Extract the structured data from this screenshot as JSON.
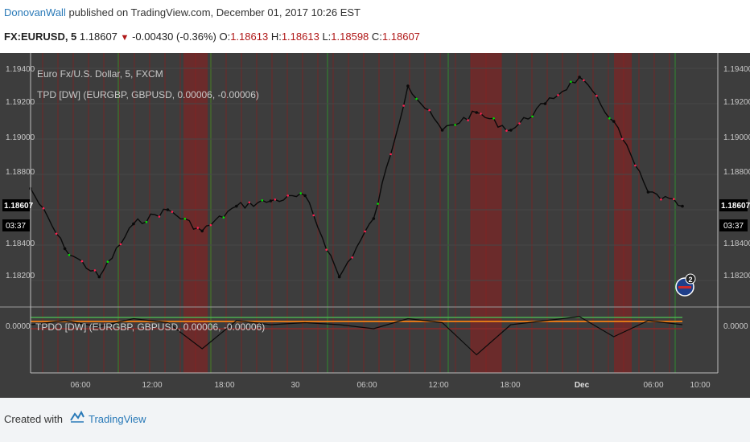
{
  "header": {
    "author": "DonovanWall",
    "published_text": " published on TradingView.com, December 01, 2017 10:26 EST",
    "symbol": "FX:EURUSD, 5",
    "last_price": "1.18607",
    "change": "-0.00430 (-0.36%)",
    "open_label": "O:",
    "open": "1.18613",
    "high_label": "H:",
    "high": "1.18613",
    "low_label": "L:",
    "low": "1.18598",
    "close_label": "C:",
    "close": "1.18607"
  },
  "legend": {
    "instrument": "Euro Fx/U.S. Dollar, 5, FXCM",
    "indicator": "TPD [DW] (EURGBP, GBPUSD, 0.00006, -0.00006)",
    "oscillator": "TPDO [DW] (EURGBP, GBPUSD, 0.00006, -0.00006)"
  },
  "price_axis": {
    "ticks": [
      "1.19400",
      "1.19200",
      "1.19000",
      "1.18800",
      "1.18400",
      "1.18200"
    ],
    "current_price": "1.18607",
    "countdown": "03:37"
  },
  "osc_axis": {
    "ticks": [
      "0.0000"
    ]
  },
  "time_axis": {
    "ticks": [
      "06:00",
      "12:00",
      "18:00",
      "30",
      "06:00",
      "12:00",
      "18:00",
      "Dec",
      "06:00",
      "10:00"
    ]
  },
  "event_badge": {
    "count": "2"
  },
  "colors": {
    "background": "#3d3d3d",
    "price_line": "#0a0a0a",
    "bull_signal": "#00e000",
    "bear_signal": "#ff2050",
    "bear_zone": "#8a1f1f",
    "bull_zone_line": "#2f8a2f",
    "osc_band_orange": "#e07818",
    "osc_band_green": "#4caf50"
  },
  "chart_data": [
    {
      "type": "line",
      "title": "Euro Fx/U.S. Dollar, 5, FXCM",
      "xlabel": "",
      "ylabel": "",
      "x": [
        "Nov 29 00:00",
        "Nov 29 03:00",
        "Nov 29 06:00",
        "Nov 29 09:00",
        "Nov 29 12:00",
        "Nov 29 15:00",
        "Nov 29 18:00",
        "Nov 29 21:00",
        "Nov 30 00:00",
        "Nov 30 03:00",
        "Nov 30 06:00",
        "Nov 30 09:00",
        "Nov 30 12:00",
        "Nov 30 15:00",
        "Nov 30 18:00",
        "Nov 30 21:00",
        "Dec 01 00:00",
        "Dec 01 03:00",
        "Dec 01 06:00",
        "Dec 01 08:40"
      ],
      "series": [
        {
          "name": "",
          "values": [
            1.1872,
            1.1838,
            1.1822,
            1.1852,
            1.186,
            1.1848,
            1.1862,
            1.1865,
            1.1868,
            1.1822,
            1.1855,
            1.193,
            1.1905,
            1.1915,
            1.1905,
            1.192,
            1.1935,
            1.191,
            1.187,
            1.1862
          ]
        }
      ],
      "ylim": [
        1.181,
        1.1945
      ],
      "y_ticks": [
        1.182,
        1.184,
        1.186,
        1.188,
        1.19,
        1.192,
        1.194
      ]
    },
    {
      "type": "line",
      "title": "TPDO [DW] (EURGBP, GBPUSD, 0.00006, -0.00006)",
      "xlabel": "",
      "ylabel": "",
      "x": [
        "Nov 29 00:00",
        "Nov 29 03:00",
        "Nov 29 06:00",
        "Nov 29 09:00",
        "Nov 29 12:00",
        "Nov 29 15:00",
        "Nov 29 18:00",
        "Nov 29 21:00",
        "Nov 30 00:00",
        "Nov 30 03:00",
        "Nov 30 06:00",
        "Nov 30 09:00",
        "Nov 30 12:00",
        "Nov 30 15:00",
        "Nov 30 18:00",
        "Nov 30 21:00",
        "Dec 01 00:00",
        "Dec 01 03:00",
        "Dec 01 06:00",
        "Dec 01 08:40"
      ],
      "series": [
        {
          "name": "",
          "values": [
            0.0,
            2e-05,
            -1e-05,
            3e-05,
            1e-05,
            -0.00012,
            2e-05,
            0.0,
            1e-05,
            0.0,
            -2e-05,
            3e-05,
            1e-05,
            -0.00015,
            0.0,
            2e-05,
            4e-05,
            -6e-05,
            2e-05,
            0.0
          ]
        }
      ],
      "bands": [
        6e-05,
        -6e-05
      ],
      "y_ticks": [
        0.0
      ]
    }
  ]
}
